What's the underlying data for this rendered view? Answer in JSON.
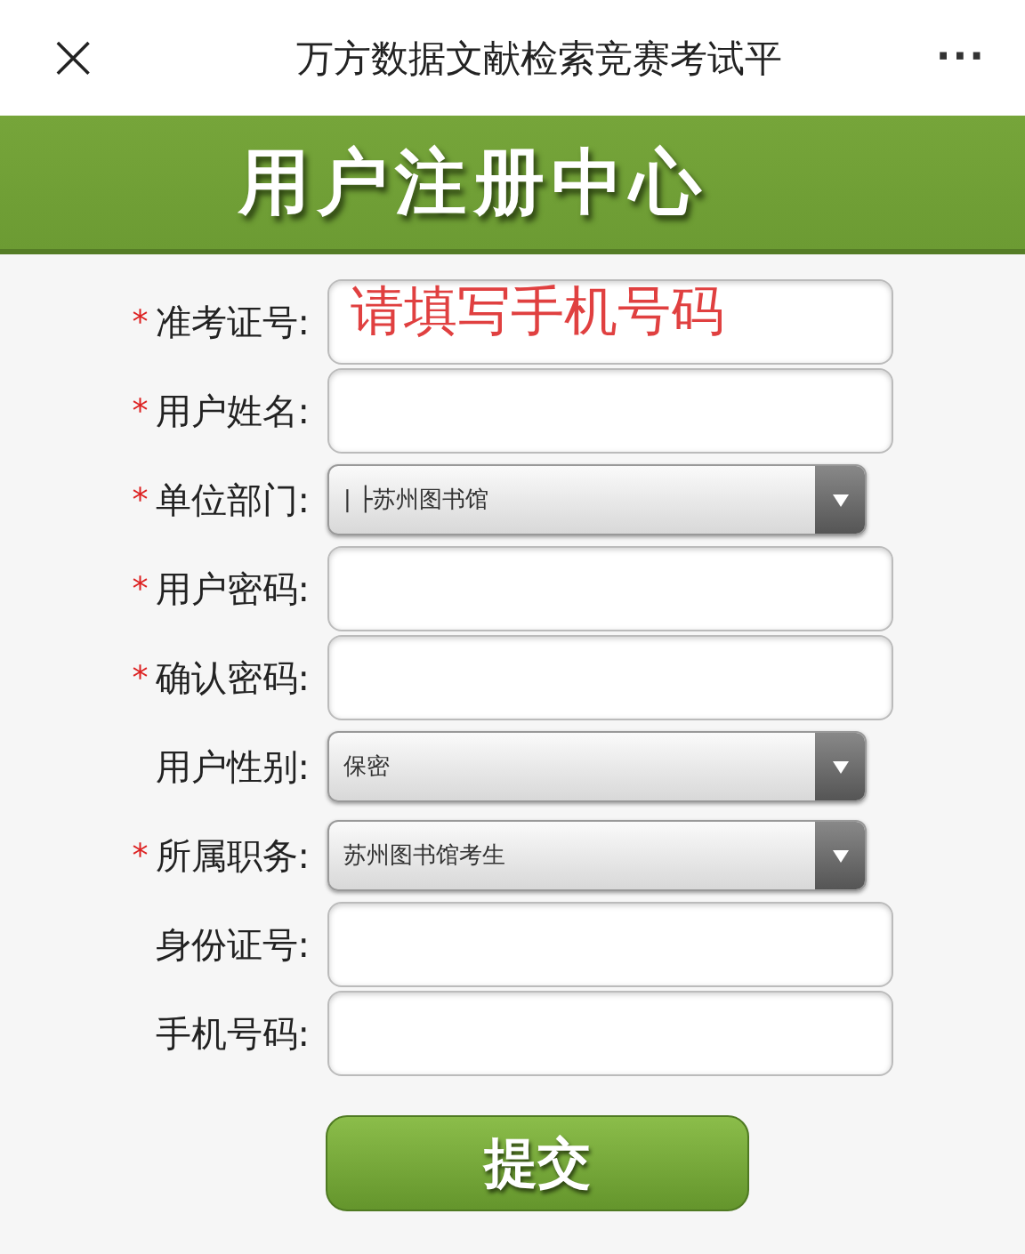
{
  "window": {
    "title": "万方数据文献检索竞赛考试平",
    "close": "×",
    "more": "···"
  },
  "banner": {
    "title": "用户注册中心"
  },
  "fields": [
    {
      "kind": "text",
      "label": "准考证号:",
      "required_mark": "*",
      "placeholder": "请填写手机号码"
    },
    {
      "kind": "text",
      "label": "用户姓名:",
      "required_mark": "*"
    },
    {
      "kind": "select",
      "label": "单位部门:",
      "required_mark": "*",
      "value": "| ├苏州图书馆"
    },
    {
      "kind": "text",
      "label": "用户密码:",
      "required_mark": "*"
    },
    {
      "kind": "text",
      "label": "确认密码:",
      "required_mark": "*"
    },
    {
      "kind": "select",
      "label": "用户性别:",
      "value": "保密"
    },
    {
      "kind": "select",
      "label": "所属职务:",
      "required_mark": "*",
      "value": "苏州图书馆考生"
    },
    {
      "kind": "text",
      "label": "身份证号:"
    },
    {
      "kind": "text",
      "label": "手机号码:"
    }
  ],
  "submit": {
    "label": "提交"
  }
}
